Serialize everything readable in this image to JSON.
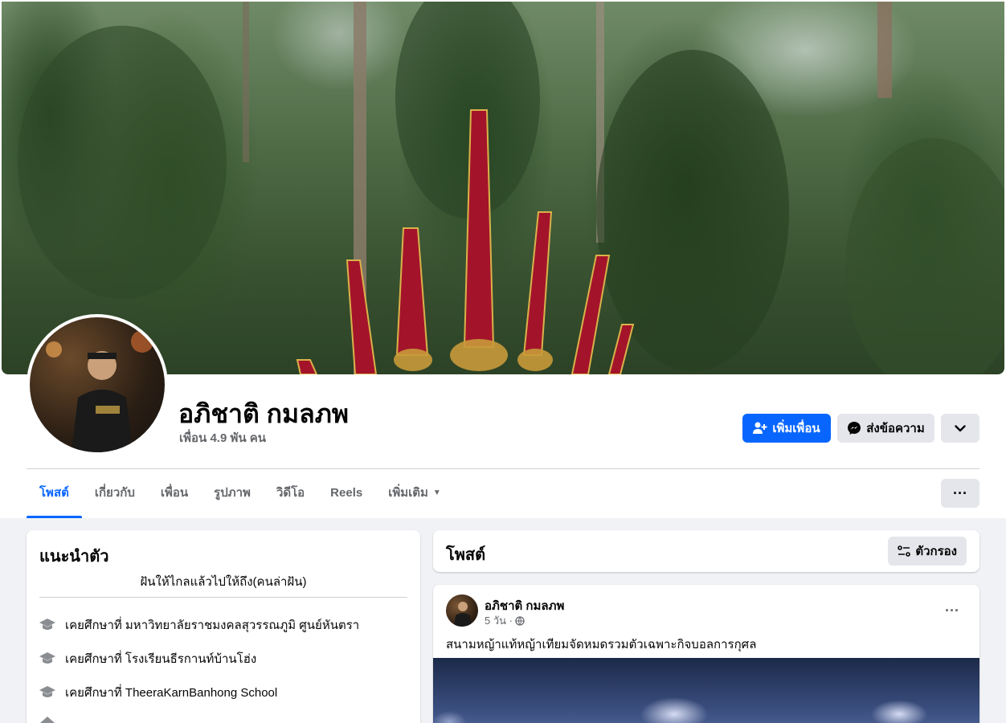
{
  "profile": {
    "name": "อภิชาติ กมลภพ",
    "friends_count": "เพื่อน 4.9 พัน คน"
  },
  "actions": {
    "add_friend": "เพิ่มเพื่อน",
    "message": "ส่งข้อความ"
  },
  "tabs": [
    {
      "label": "โพสต์",
      "active": true
    },
    {
      "label": "เกี่ยวกับ"
    },
    {
      "label": "เพื่อน"
    },
    {
      "label": "รูปภาพ"
    },
    {
      "label": "วิดีโอ"
    },
    {
      "label": "Reels"
    },
    {
      "label": "เพิ่มเติม"
    }
  ],
  "intro": {
    "title": "แนะนำตัว",
    "bio": "ฝันให้ไกลแล้วไปให้ถึง(คนล่าฝัน)",
    "items": [
      {
        "icon": "graduation-cap-icon",
        "text": "เคยศึกษาที่ มหาวิทยาลัยราชมงคลสุวรรณภูมิ ศูนย์หันตรา"
      },
      {
        "icon": "graduation-cap-icon",
        "text": "เคยศึกษาที่ โรงเรียนธีรกานท์บ้านโฮ่ง"
      },
      {
        "icon": "graduation-cap-icon",
        "text": "เคยศึกษาที่ TheeraKarnBanhong School"
      }
    ]
  },
  "posts_section": {
    "title": "โพสต์",
    "filter_label": "ตัวกรอง"
  },
  "post": {
    "author": "อภิชาติ กมลภพ",
    "time": "5 วัน ·",
    "text": "สนามหญ้าแท้หญ้าเทียมจัดหมดรวมตัวเฉพาะกิจบอลการกุศล"
  },
  "colors": {
    "primary": "#0866ff",
    "secondary_button": "#e4e6eb",
    "background": "#f0f2f5"
  }
}
